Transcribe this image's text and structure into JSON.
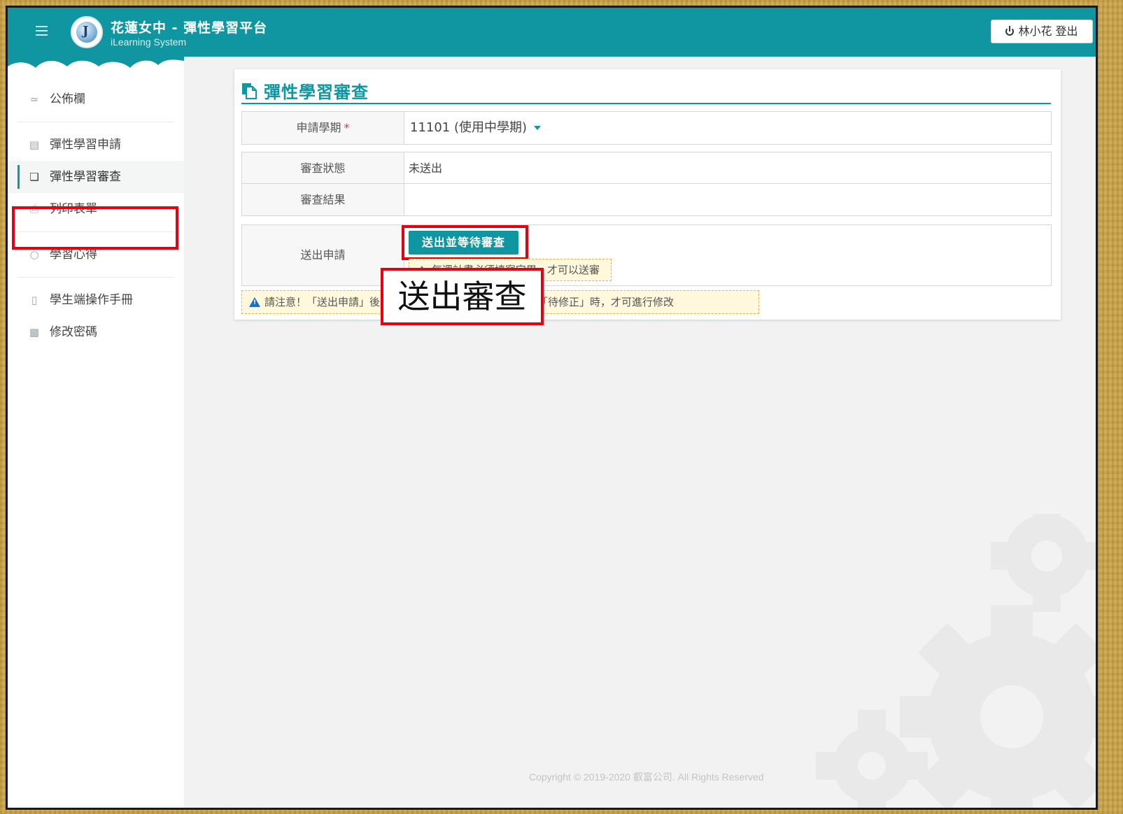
{
  "header": {
    "app_title": "花蓮女中 - 彈性學習平台",
    "app_subtitle": "iLearning System",
    "logout_label": "林小花 登出",
    "accent_color": "#0f96a1"
  },
  "sidebar": {
    "items": [
      {
        "label": "公佈欄",
        "icon": "rss-icon"
      },
      {
        "label": "彈性學習申請",
        "icon": "file-icon"
      },
      {
        "label": "彈性學習審查",
        "icon": "copy-icon",
        "active": true
      },
      {
        "label": "列印表單",
        "icon": "print-icon"
      },
      {
        "label": "學習心得",
        "icon": "comment-icon"
      },
      {
        "label": "學生端操作手冊",
        "icon": "book-icon"
      },
      {
        "label": "修改密碼",
        "icon": "lock-icon"
      }
    ]
  },
  "main": {
    "title": "彈性學習審查",
    "semester_label": "申請學期",
    "required_mark": "*",
    "semester_value": "11101 (使用中學期)",
    "review_status_label": "審查狀態",
    "review_status_value": "未送出",
    "review_result_label": "審查結果",
    "review_result_value": "",
    "submit_label": "送出申請",
    "submit_button": "送出並等待審查",
    "inline_warning": "每週計畫必須填寫完畢，才可以送審",
    "notice": "請注意！「送出申請」後，須等待審核。若「審查狀態」為「待修正」時，才可進行修改"
  },
  "callout": {
    "text": "送出審查",
    "color": "#e60012"
  },
  "footer": {
    "copyright": "Copyright © 2019-2020 叡富公司. All Rights Reserved"
  }
}
